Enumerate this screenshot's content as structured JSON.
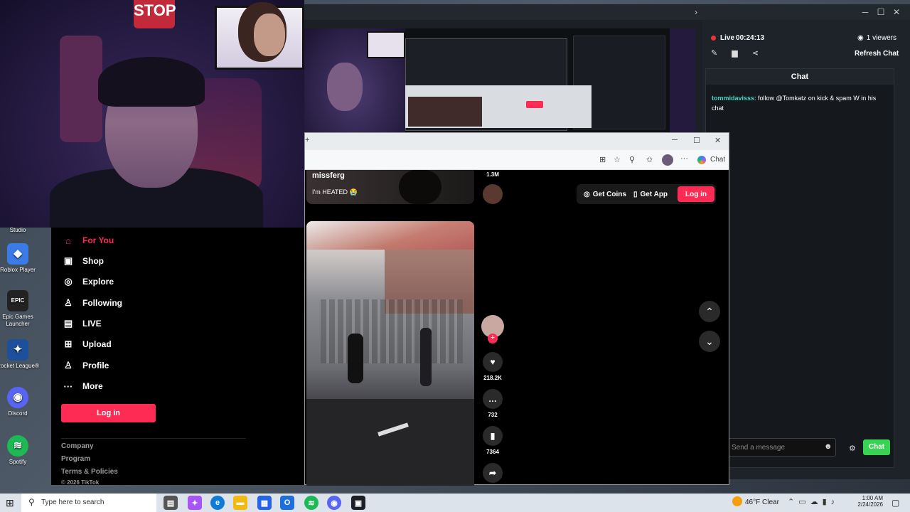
{
  "webcam": {
    "stop_text": "STOP"
  },
  "desktop_icons": [
    {
      "label": "Studio",
      "color": "#444"
    },
    {
      "label": "Roblox Player",
      "color": "#3b7be8",
      "glyph": "◆"
    },
    {
      "label": "Epic Games Launcher",
      "color": "#222",
      "glyph": "EPIC"
    },
    {
      "label": "Rocket League®",
      "color": "#1d4f9b",
      "glyph": "✦"
    },
    {
      "label": "Discord",
      "color": "#5865f2",
      "glyph": "◉"
    },
    {
      "label": "Spotify",
      "color": "#1db954",
      "glyph": "≋"
    }
  ],
  "app": {
    "live_label": "Live",
    "live_time": "00:24:13",
    "viewers": "1 viewers",
    "refresh_chat": "Refresh Chat",
    "chat_header": "Chat",
    "chat_messages": [
      {
        "user": "tommidavisss",
        "text": ": follow @Tomkatz on kick & spam W in his chat"
      }
    ],
    "message_placeholder": "Send a message",
    "chat_button": "Chat",
    "accent": "#39d353"
  },
  "browser": {
    "copilot_label": "Chat",
    "prev_video": {
      "author": "missferg",
      "caption": "I'm HEATED 😭",
      "likes": "1.3M"
    },
    "get_coins": "Get Coins",
    "get_app": "Get App",
    "login_top": "Log in",
    "rail": {
      "likes": "218.2K",
      "comments": "732",
      "saves": "7364"
    }
  },
  "tiktok_nav": {
    "items": [
      {
        "label": "For You",
        "icon": "home-icon",
        "active": true
      },
      {
        "label": "Shop",
        "icon": "shop-icon"
      },
      {
        "label": "Explore",
        "icon": "compass-icon"
      },
      {
        "label": "Following",
        "icon": "following-icon"
      },
      {
        "label": "LIVE",
        "icon": "live-icon"
      },
      {
        "label": "Upload",
        "icon": "upload-icon"
      },
      {
        "label": "Profile",
        "icon": "profile-icon"
      },
      {
        "label": "More",
        "icon": "more-icon"
      }
    ],
    "login_button": "Log in",
    "footer": [
      "Company",
      "Program",
      "Terms & Policies",
      "© 2026 TikTok"
    ],
    "accent": "#fe2c55"
  },
  "taskbar": {
    "search_placeholder": "Type here to search",
    "weather": "46°F  Clear",
    "time": "1:00 AM",
    "date": "2/24/2026"
  }
}
